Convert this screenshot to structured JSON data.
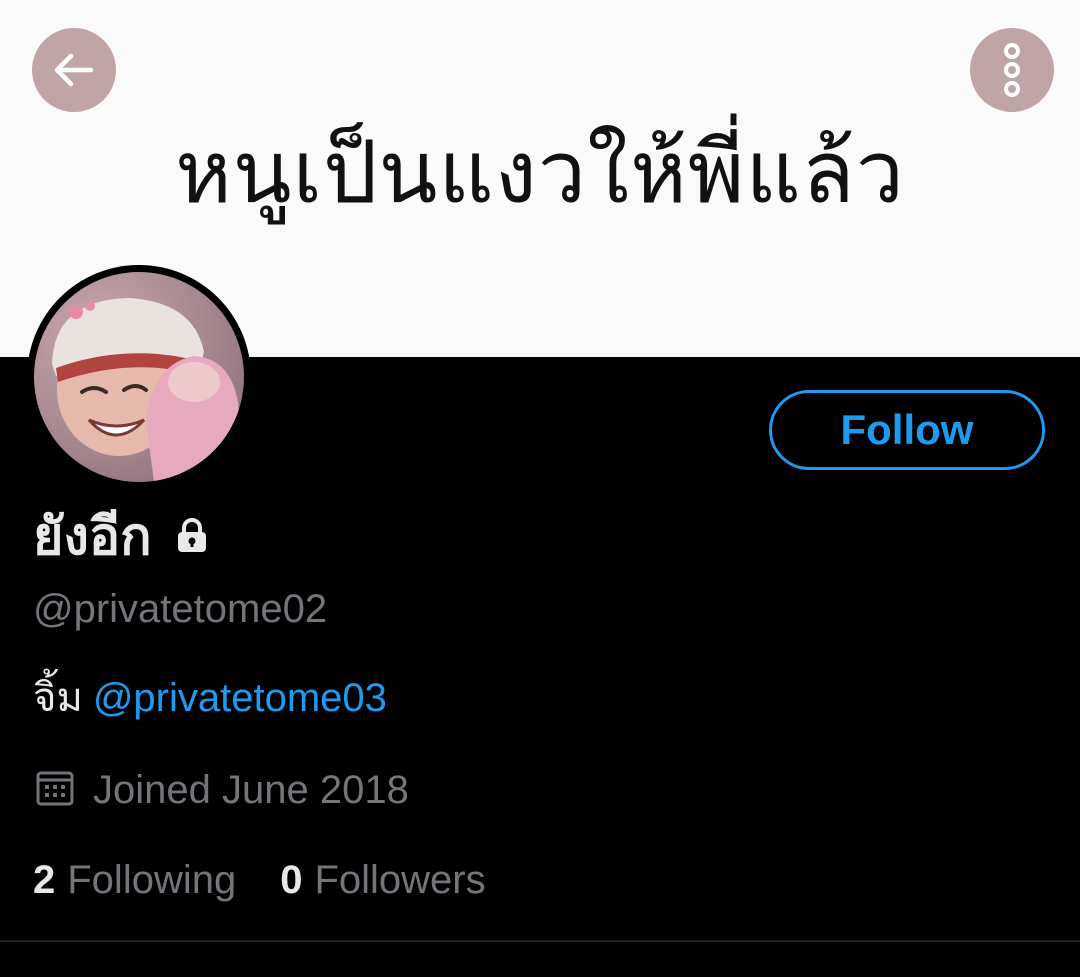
{
  "header": {
    "banner_text": "หนูเป็นแงวให้พี่แล้ว",
    "back_icon": "arrow-left-icon",
    "more_icon": "more-vertical-icon",
    "button_color": "#bfa5a6"
  },
  "profile": {
    "display_name": "ยังอีก",
    "protected_icon": "lock-icon",
    "handle": "@privatetome02",
    "bio_text": "จิ้ม",
    "bio_mention": "@privatetome03",
    "joined_icon": "calendar-icon",
    "joined": "Joined June 2018",
    "following_count": "2",
    "following_label": "Following",
    "followers_count": "0",
    "followers_label": "Followers"
  },
  "actions": {
    "follow_label": "Follow"
  },
  "colors": {
    "accent": "#1d9bf0",
    "background": "#000000",
    "secondary_text": "#71767b"
  }
}
